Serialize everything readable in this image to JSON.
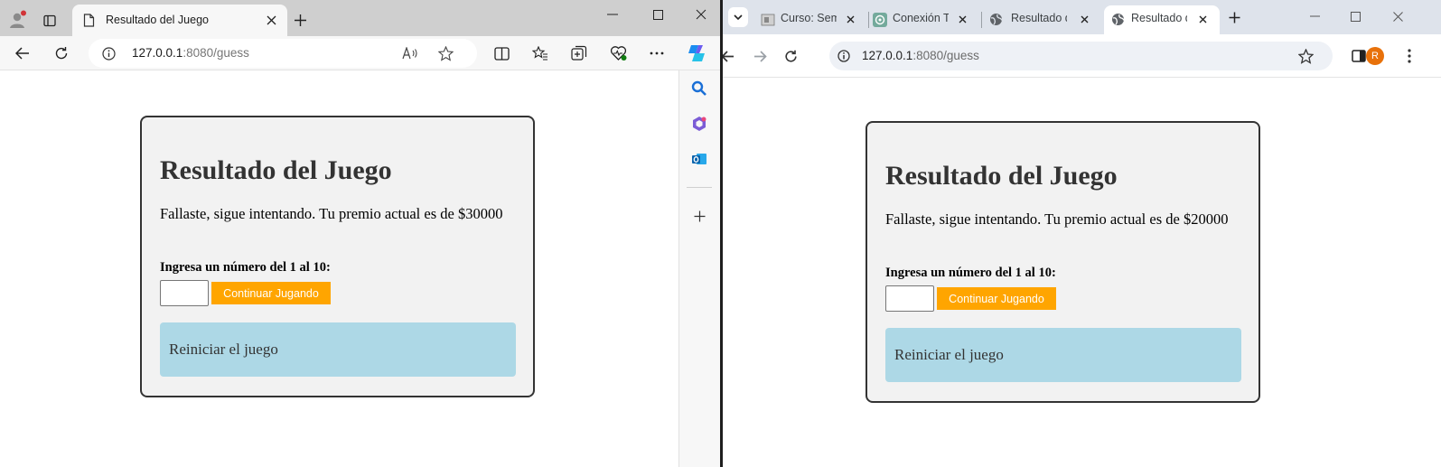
{
  "left_browser": {
    "tab_title": "Resultado del Juego",
    "url_host": "127.0.0.1",
    "url_rest": ":8080/guess"
  },
  "right_browser": {
    "tabs": [
      {
        "title": "Curso: Semi"
      },
      {
        "title": "Conexión Te"
      },
      {
        "title": "Resultado d"
      },
      {
        "title": "Resultado d"
      }
    ],
    "url_host": "127.0.0.1",
    "url_rest": ":8080/guess",
    "profile_initial": "R"
  },
  "left_page": {
    "heading": "Resultado del Juego",
    "message": "Fallaste, sigue intentando. Tu premio actual es de $30000",
    "input_label": "Ingresa un número del 1 al 10:",
    "continue_button": "Continuar Jugando",
    "reset_link": "Reiniciar el juego"
  },
  "right_page": {
    "heading": "Resultado del Juego",
    "message": "Fallaste, sigue intentando. Tu premio actual es de $20000",
    "input_label": "Ingresa un número del 1 al 10:",
    "continue_button": "Continuar Jugando",
    "reset_link": "Reiniciar el juego"
  },
  "colors": {
    "button_bg": "#ffa500",
    "reset_bg": "#add8e6",
    "card_bg": "#f2f2f2"
  }
}
